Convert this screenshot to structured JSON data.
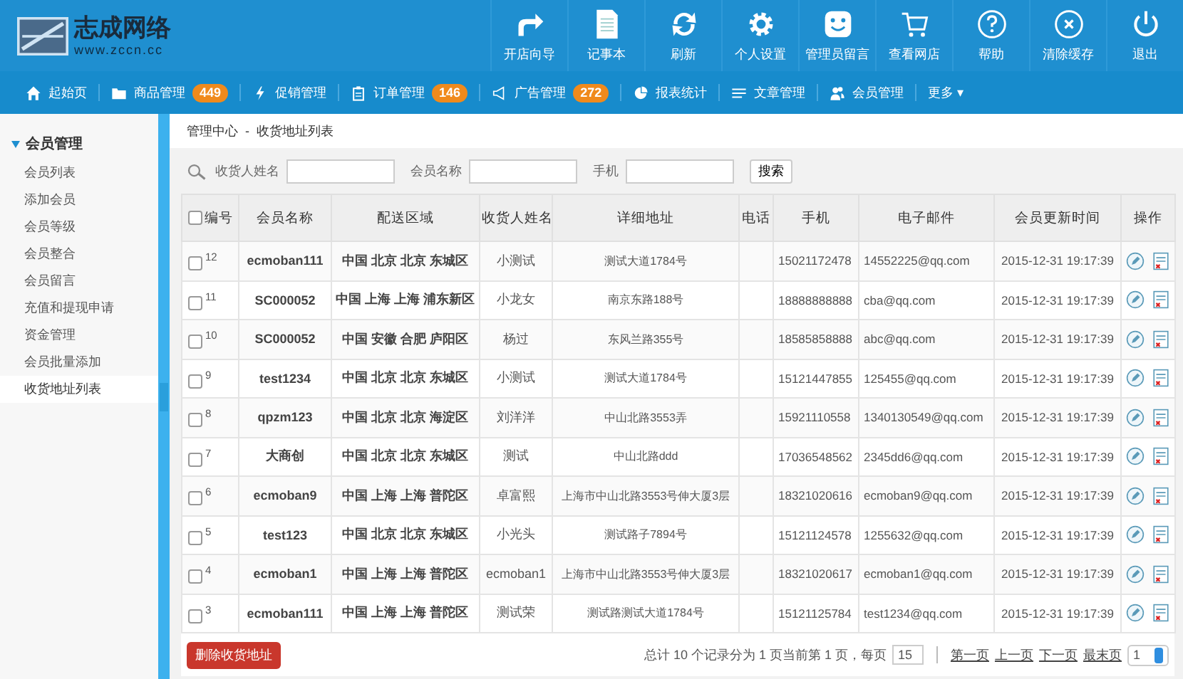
{
  "logo": {
    "title": "志成网络",
    "url": "www.zccn.cc"
  },
  "toolbar": [
    {
      "label": "开店向导"
    },
    {
      "label": "记事本"
    },
    {
      "label": "刷新"
    },
    {
      "label": "个人设置"
    },
    {
      "label": "管理员留言"
    },
    {
      "label": "查看网店"
    },
    {
      "label": "帮助"
    },
    {
      "label": "清除缓存"
    },
    {
      "label": "退出"
    }
  ],
  "nav": [
    {
      "label": "起始页"
    },
    {
      "label": "商品管理",
      "badge": "449"
    },
    {
      "label": "促销管理"
    },
    {
      "label": "订单管理",
      "badge": "146"
    },
    {
      "label": "广告管理",
      "badge": "272"
    },
    {
      "label": "报表统计"
    },
    {
      "label": "文章管理"
    },
    {
      "label": "会员管理"
    },
    {
      "label": "更多",
      "caret": "▾"
    }
  ],
  "sidebar": {
    "title": "会员管理",
    "expanded": true,
    "items": [
      {
        "label": "会员列表",
        "selected": false
      },
      {
        "label": "添加会员",
        "selected": false
      },
      {
        "label": "会员等级",
        "selected": false
      },
      {
        "label": "会员整合",
        "selected": false
      },
      {
        "label": "会员留言",
        "selected": false
      },
      {
        "label": "充值和提现申请",
        "selected": false
      },
      {
        "label": "资金管理",
        "selected": false
      },
      {
        "label": "会员批量添加",
        "selected": false
      },
      {
        "label": "收货地址列表",
        "selected": true
      }
    ]
  },
  "breadcrumb": [
    "管理中心",
    "-",
    "收货地址列表"
  ],
  "search": {
    "fields": [
      {
        "label": "收货人姓名"
      },
      {
        "label": "会员名称"
      },
      {
        "label": "手机"
      }
    ],
    "button": "搜索"
  },
  "table": {
    "all_checked": false,
    "columns": [
      "编号",
      "会员名称",
      "配送区域",
      "收货人姓名",
      "详细地址",
      "电话",
      "手机",
      "电子邮件",
      "会员更新时间",
      "操作"
    ],
    "rows": [
      {
        "checked": false,
        "id": "12",
        "member": "ecmoban111",
        "region": "中国 北京 北京 东城区",
        "name": "小测试",
        "address": "测试大道1784号",
        "phone": "",
        "mobile": "15021172478",
        "email": "14552225@qq.com",
        "time": "2015-12-31 19:17:39"
      },
      {
        "checked": false,
        "id": "11",
        "member": "SC000052",
        "region": "中国 上海 上海 浦东新区",
        "name": "小龙女",
        "address": "南京东路188号",
        "phone": "",
        "mobile": "18888888888",
        "email": "cba@qq.com",
        "time": "2015-12-31 19:17:39"
      },
      {
        "checked": false,
        "id": "10",
        "member": "SC000052",
        "region": "中国 安徽 合肥 庐阳区",
        "name": "杨过",
        "address": "东风兰路355号",
        "phone": "",
        "mobile": "18585858888",
        "email": "abc@qq.com",
        "time": "2015-12-31 19:17:39"
      },
      {
        "checked": false,
        "id": "9",
        "member": "test1234",
        "region": "中国 北京 北京 东城区",
        "name": "小测试",
        "address": "测试大道1784号",
        "phone": "",
        "mobile": "15121447855",
        "email": "125455@qq.com",
        "time": "2015-12-31 19:17:39"
      },
      {
        "checked": false,
        "id": "8",
        "member": "qpzm123",
        "region": "中国 北京 北京 海淀区",
        "name": "刘洋洋",
        "address": "中山北路3553弄",
        "phone": "",
        "mobile": "15921110558",
        "email": "1340130549@qq.com",
        "time": "2015-12-31 19:17:39"
      },
      {
        "checked": false,
        "id": "7",
        "member": "大商创",
        "region": "中国 北京 北京 东城区",
        "name": "测试",
        "address": "中山北路ddd",
        "phone": "",
        "mobile": "17036548562",
        "email": "2345dd6@qq.com",
        "time": "2015-12-31 19:17:39"
      },
      {
        "checked": false,
        "id": "6",
        "member": "ecmoban9",
        "region": "中国 上海 上海 普陀区",
        "name": "卓富熙",
        "address": "上海市中山北路3553号伸大厦3层",
        "phone": "",
        "mobile": "18321020616",
        "email": "ecmoban9@qq.com",
        "time": "2015-12-31 19:17:39"
      },
      {
        "checked": false,
        "id": "5",
        "member": "test123",
        "region": "中国 北京 北京 东城区",
        "name": "小光头",
        "address": "测试路子7894号",
        "phone": "",
        "mobile": "15121124578",
        "email": "1255632@qq.com",
        "time": "2015-12-31 19:17:39"
      },
      {
        "checked": false,
        "id": "4",
        "member": "ecmoban1",
        "region": "中国 上海 上海 普陀区",
        "name": "ecmoban1",
        "address": "上海市中山北路3553号伸大厦3层",
        "phone": "",
        "mobile": "18321020617",
        "email": "ecmoban1@qq.com",
        "time": "2015-12-31 19:17:39"
      },
      {
        "checked": false,
        "id": "3",
        "member": "ecmoban111",
        "region": "中国 上海 上海 普陀区",
        "name": "测试荣",
        "address": "测试路测试大道1784号",
        "phone": "",
        "mobile": "15121125784",
        "email": "test1234@qq.com",
        "time": "2015-12-31 19:17:39"
      }
    ]
  },
  "footer": {
    "delete_button": "删除收货地址",
    "summary": "总计 10 个记录分为 1 页当前第 1 页，每页",
    "per_page": "15",
    "links": [
      "第一页",
      "上一页",
      "下一页",
      "最末页"
    ],
    "page": "1"
  }
}
